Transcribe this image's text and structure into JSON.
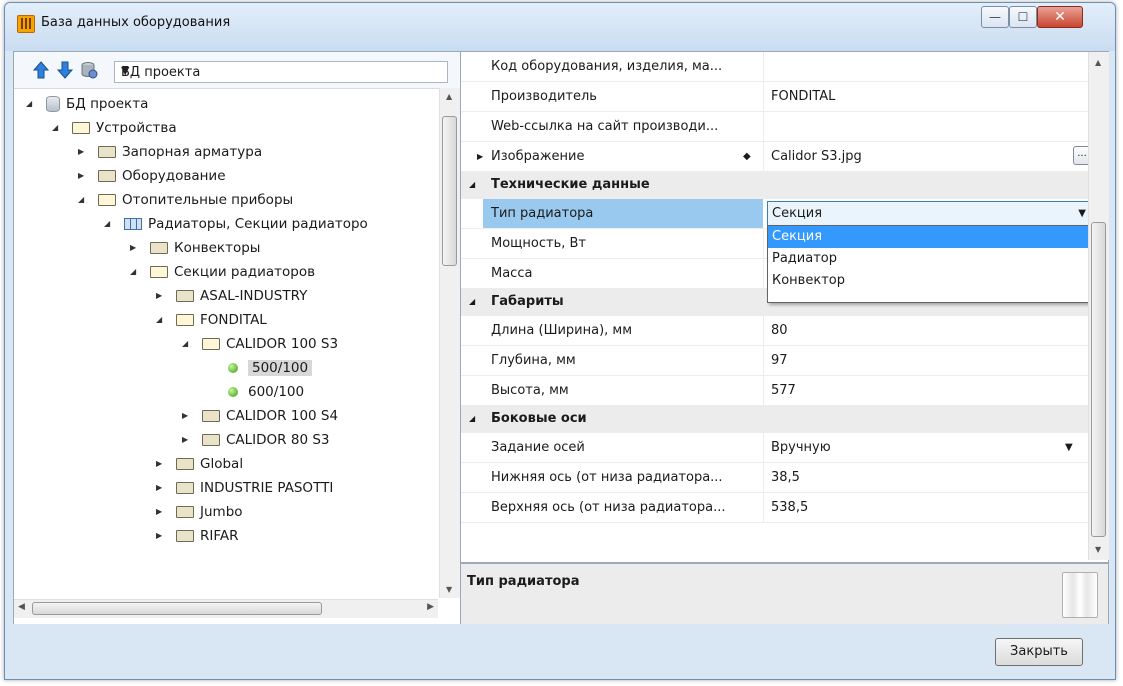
{
  "window": {
    "title": "База данных оборудования",
    "controls": {
      "minimize": "—",
      "maximize": "☐",
      "close": "✕"
    }
  },
  "left_panel": {
    "toolbar": {
      "db_select_value": "БД проекта"
    },
    "tree": [
      {
        "label": "БД проекта",
        "level": 0,
        "icon": "database-icon",
        "state": "expanded"
      },
      {
        "label": "Устройства",
        "level": 1,
        "icon": "folder-open-icon",
        "state": "expanded"
      },
      {
        "label": "Запорная арматура",
        "level": 2,
        "icon": "folder-icon",
        "state": "collapsed"
      },
      {
        "label": "Оборудование",
        "level": 2,
        "icon": "folder-icon",
        "state": "collapsed"
      },
      {
        "label": "Отопительные приборы",
        "level": 2,
        "icon": "folder-open-icon",
        "state": "expanded"
      },
      {
        "label": "Радиаторы, Секции радиаторо",
        "level": 3,
        "icon": "table-icon",
        "state": "expanded"
      },
      {
        "label": "Конвекторы",
        "level": 4,
        "icon": "folder-icon",
        "state": "collapsed"
      },
      {
        "label": "Секции радиаторов",
        "level": 4,
        "icon": "folder-open-icon",
        "state": "expanded"
      },
      {
        "label": "ASAL-INDUSTRY",
        "level": 5,
        "icon": "folder-icon",
        "state": "collapsed"
      },
      {
        "label": "FONDITAL",
        "level": 5,
        "icon": "folder-open-icon",
        "state": "expanded"
      },
      {
        "label": "CALIDOR 100 S3",
        "level": 6,
        "icon": "folder-open-icon",
        "state": "expanded"
      },
      {
        "label": "500/100",
        "level": 7,
        "icon": "green-dot-icon",
        "state": "selected"
      },
      {
        "label": "600/100",
        "level": 7,
        "icon": "green-dot-icon",
        "state": "leaf"
      },
      {
        "label": "CALIDOR 100 S4",
        "level": 6,
        "icon": "folder-icon",
        "state": "collapsed"
      },
      {
        "label": "CALIDOR 80 S3",
        "level": 6,
        "icon": "folder-icon",
        "state": "collapsed"
      },
      {
        "label": "Global",
        "level": 5,
        "icon": "folder-icon",
        "state": "collapsed"
      },
      {
        "label": "INDUSTRIE PASOTTI",
        "level": 5,
        "icon": "folder-icon",
        "state": "collapsed"
      },
      {
        "label": "Jumbo",
        "level": 5,
        "icon": "folder-icon",
        "state": "collapsed"
      },
      {
        "label": "RIFAR",
        "level": 5,
        "icon": "folder-icon",
        "state": "collapsed"
      }
    ]
  },
  "properties": {
    "rows": {
      "code": {
        "name": "Код оборудования, изделия, ма...",
        "value": ""
      },
      "manufacturer": {
        "name": "Производитель",
        "value": "FONDITAL"
      },
      "weblink": {
        "name": "Web-ссылка на сайт производи...",
        "value": ""
      },
      "image": {
        "name": "Изображение",
        "value": "Calidor S3.jpg",
        "button": "..."
      },
      "cat_tech": {
        "name": "Технические данные"
      },
      "radiator_type": {
        "name": "Тип радиатора",
        "value": "Секция"
      },
      "power": {
        "name": "Мощность, Вт",
        "value": ""
      },
      "mass": {
        "name": "Масса",
        "value": ""
      },
      "cat_dims": {
        "name": "Габариты"
      },
      "length": {
        "name": "Длина (Ширина), мм",
        "value": "80"
      },
      "depth": {
        "name": "Глубина, мм",
        "value": "97"
      },
      "height": {
        "name": "Высота, мм",
        "value": "577"
      },
      "cat_axes": {
        "name": "Боковые оси"
      },
      "axes_mode": {
        "name": "Задание осей",
        "value": "Вручную"
      },
      "lower_axis": {
        "name": "Нижняя ось (от низа радиатора...",
        "value": "38,5"
      },
      "upper_axis": {
        "name": "Верхняя ось (от низа радиатора...",
        "value": "538,5"
      }
    },
    "dropdown_options": [
      "Секция",
      "Радиатор",
      "Конвектор"
    ],
    "description_title": "Тип радиатора"
  },
  "footer": {
    "close_label": "Закрыть"
  },
  "glyphs": {
    "expanded": "◢",
    "collapsed": "▶",
    "dropdown": "▼",
    "scroll_up": "▲",
    "scroll_down": "▼",
    "scroll_left": "◀",
    "scroll_right": "▶",
    "diamond": "◆",
    "grip": "≡"
  }
}
